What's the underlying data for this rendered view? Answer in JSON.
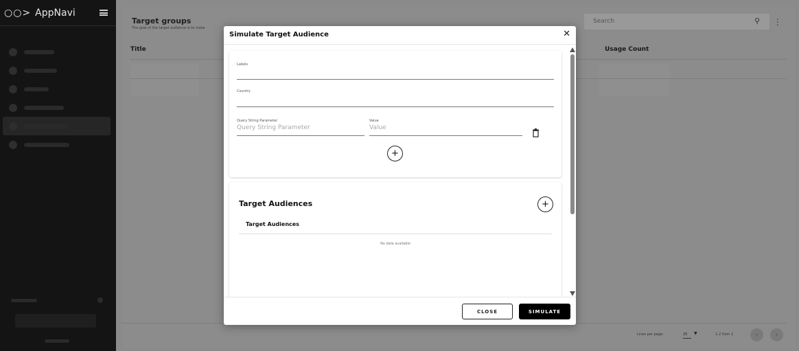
{
  "app": {
    "logo_mark": "○○>",
    "name": "AppNavi"
  },
  "page": {
    "title": "Target groups",
    "subtitle": "The goal of the target audience is to make",
    "search_placeholder": "Search",
    "columns": [
      "Title",
      "Usage Count"
    ],
    "pagination": {
      "lines_per_page_label": "Lines per page:",
      "lines_per_page": "25",
      "range": "1-2 from 2"
    }
  },
  "modal": {
    "title": "Simulate Target Audience",
    "fields": {
      "labels": {
        "label": "Labels"
      },
      "country": {
        "label": "Country"
      },
      "query_param": {
        "label": "Query String Parameter",
        "placeholder": "Query String Parameter"
      },
      "value": {
        "label": "Value",
        "placeholder": "Value"
      }
    },
    "target_audiences": {
      "title": "Target Audiences",
      "column": "Target Audiences",
      "empty": "No data available"
    },
    "buttons": {
      "close": "CLOSE",
      "simulate": "SIMULATE"
    }
  },
  "icons": {
    "hamburger": "hamburger-icon",
    "search": "search-icon",
    "kebab": "kebab-menu-icon",
    "close": "close-icon",
    "trash": "trash-icon",
    "add": "add-circle-icon",
    "chevron_left": "chevron-left-icon",
    "chevron_right": "chevron-right-icon"
  }
}
